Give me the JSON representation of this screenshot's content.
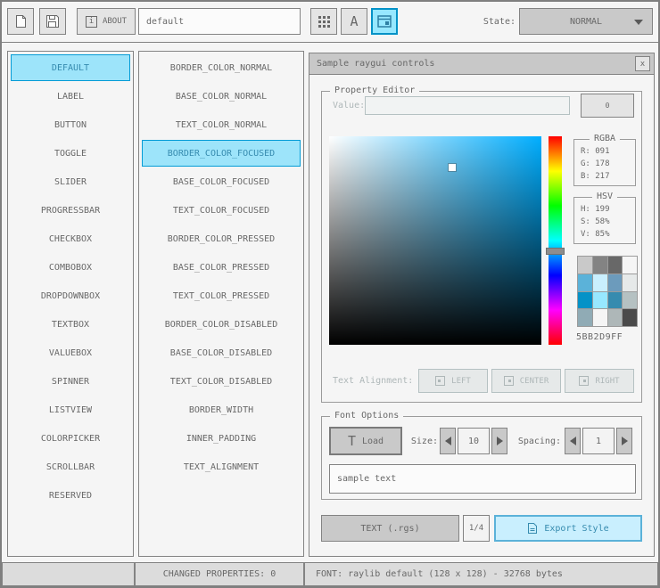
{
  "toolbar": {
    "about_label": "ABOUT",
    "style_name_value": "default",
    "state_label": "State:",
    "state_value": "NORMAL"
  },
  "lists": {
    "controls": [
      "DEFAULT",
      "LABEL",
      "BUTTON",
      "TOGGLE",
      "SLIDER",
      "PROGRESSBAR",
      "CHECKBOX",
      "COMBOBOX",
      "DROPDOWNBOX",
      "TEXTBOX",
      "VALUEBOX",
      "SPINNER",
      "LISTVIEW",
      "COLORPICKER",
      "SCROLLBAR",
      "RESERVED"
    ],
    "selected_control": "DEFAULT",
    "properties": [
      "BORDER_COLOR_NORMAL",
      "BASE_COLOR_NORMAL",
      "TEXT_COLOR_NORMAL",
      "BORDER_COLOR_FOCUSED",
      "BASE_COLOR_FOCUSED",
      "TEXT_COLOR_FOCUSED",
      "BORDER_COLOR_PRESSED",
      "BASE_COLOR_PRESSED",
      "TEXT_COLOR_PRESSED",
      "BORDER_COLOR_DISABLED",
      "BASE_COLOR_DISABLED",
      "TEXT_COLOR_DISABLED",
      "BORDER_WIDTH",
      "INNER_PADDING",
      "TEXT_ALIGNMENT"
    ],
    "selected_property": "BORDER_COLOR_FOCUSED"
  },
  "sample": {
    "title": "Sample raygui controls",
    "property_editor": {
      "title": "Property Editor",
      "value_label": "Value:",
      "value_text": "",
      "value_button_label": "0",
      "rgba_title": "RGBA",
      "rgba_lines": [
        "R: 091",
        "G: 178",
        "B: 217"
      ],
      "hsv_title": "HSV",
      "hsv_lines": [
        "H: 199",
        "S: 58%",
        "V: 85%"
      ],
      "hex_value": "5BB2D9FF",
      "palette": [
        "#c9c9c9",
        "#838383",
        "#686868",
        "#f5f5f5",
        "#5bb2d9",
        "#c9effe",
        "#6c9bbc",
        "#e6e9e9",
        "#0492c7",
        "#97e8ff",
        "#368baf",
        "#b5c1c2",
        "#90abb5",
        "#f5f5f5",
        "#aeb7b8",
        "#4a4a4a"
      ],
      "picker": {
        "selected_hex": "#5BB2D9",
        "hue_hex": "#00aeff",
        "cursor_x_pct": 58,
        "cursor_y_pct": 15,
        "hue_pos_pct": 55.3
      },
      "alignment_label": "Text Alignment:",
      "alignment_options": [
        "LEFT",
        "CENTER",
        "RIGHT"
      ]
    },
    "font_options": {
      "title": "Font Options",
      "load_button_label": "Load",
      "size_label": "Size:",
      "size_value": "10",
      "spacing_label": "Spacing:",
      "spacing_value": "1",
      "sample_text_value": "sample text"
    },
    "footer": {
      "format_button_label": "TEXT (.rgs)",
      "page_indicator": "1/4",
      "export_button_label": "Export Style"
    }
  },
  "statusbar": {
    "changed_properties": "CHANGED PROPERTIES: 0",
    "font_info": "FONT: raylib default (128 x 128) - 32768 bytes"
  },
  "icons": {
    "info_glyph": "i",
    "font_glyph": "A",
    "load_glyph": "T",
    "close_glyph": "x"
  },
  "colors": {
    "accent_border": "#0492c7",
    "accent_fill": "#97e8ff",
    "focused_border": "#5bb2d9",
    "focused_fill": "#c9effe",
    "border_normal": "#838383",
    "text_normal": "#686868",
    "text_disabled": "#aeb7b8"
  }
}
